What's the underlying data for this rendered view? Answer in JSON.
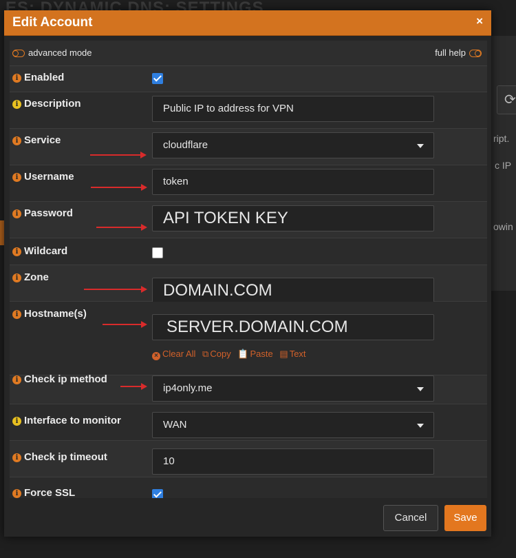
{
  "background": {
    "page_title": "ES: DYNAMIC DNS: SETTINGS",
    "snippets": [
      "ript.",
      "c IP",
      "owin"
    ]
  },
  "modal": {
    "title": "Edit Account",
    "close_glyph": "×",
    "advanced_mode_label": "advanced mode",
    "full_help_label": "full help",
    "fields": {
      "enabled": {
        "label": "Enabled",
        "checked": true
      },
      "description": {
        "label": "Description",
        "value": "Public IP to address for VPN"
      },
      "service": {
        "label": "Service",
        "value": "cloudflare"
      },
      "username": {
        "label": "Username",
        "value": "token"
      },
      "password": {
        "label": "Password",
        "value": "API TOKEN KEY"
      },
      "wildcard": {
        "label": "Wildcard",
        "checked": false
      },
      "zone": {
        "label": "Zone",
        "value": "DOMAIN.COM"
      },
      "hostnames": {
        "label": "Hostname(s)",
        "value": "SERVER.DOMAIN.COM"
      },
      "check_ip_method": {
        "label": "Check ip method",
        "value": "ip4only.me"
      },
      "interface_to_monitor": {
        "label": "Interface to monitor",
        "value": "WAN"
      },
      "check_ip_timeout": {
        "label": "Check ip timeout",
        "value": "10"
      },
      "force_ssl": {
        "label": "Force SSL",
        "checked": true
      }
    },
    "hostname_tools": {
      "clear_all": "Clear All",
      "copy": "Copy",
      "paste": "Paste",
      "text": "Text"
    },
    "footer": {
      "cancel_label": "Cancel",
      "save_label": "Save"
    }
  },
  "colors": {
    "header": "#d3731f",
    "save_button": "#e3771f",
    "checkbox_checked": "#2f7fe0",
    "annotation_arrow": "#d92b2b",
    "tool_links": "#d2612a"
  }
}
